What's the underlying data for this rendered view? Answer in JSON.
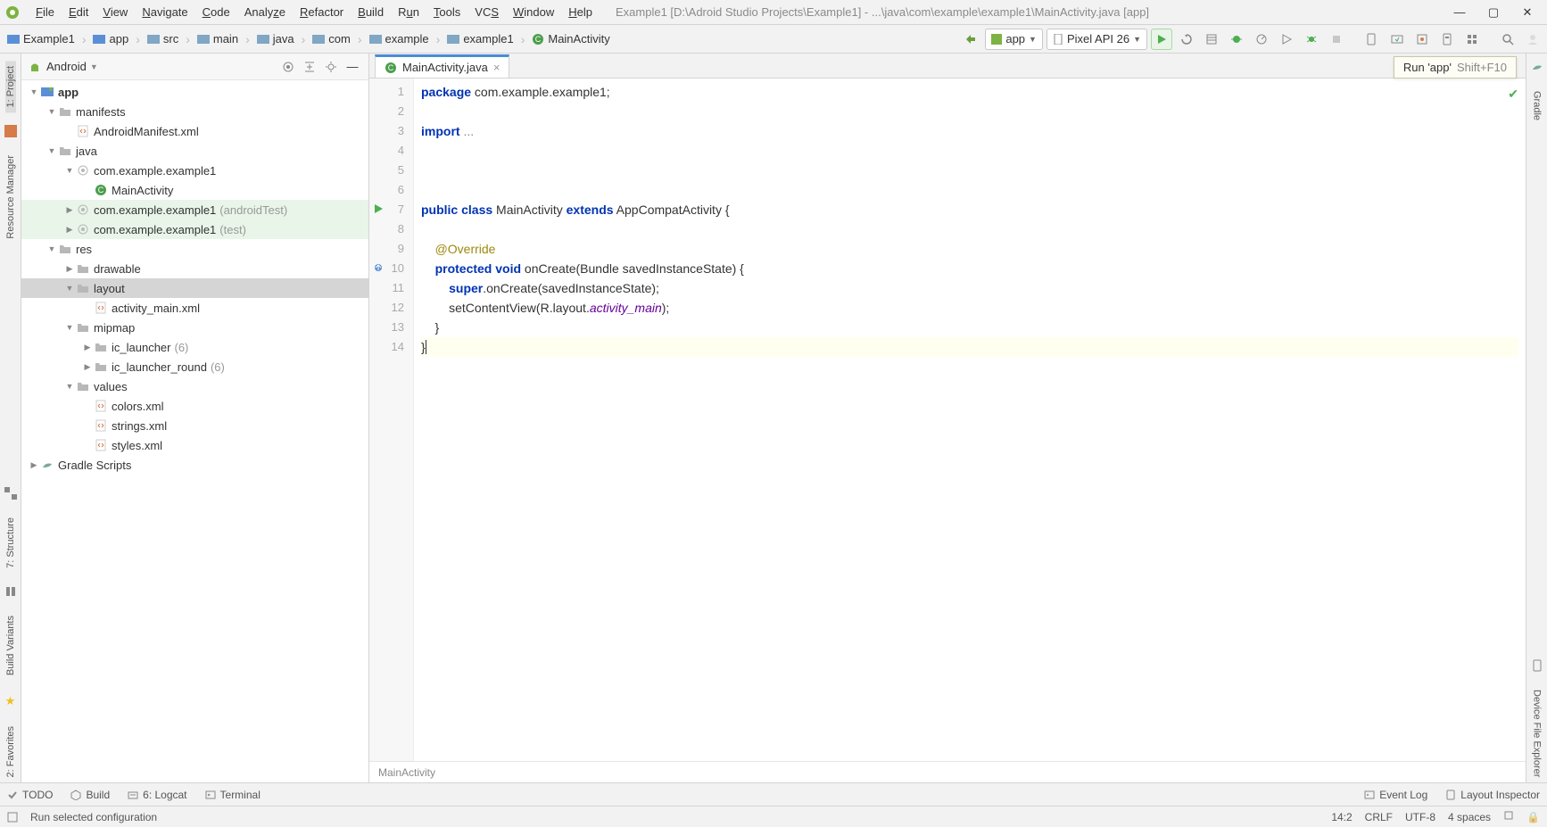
{
  "menu": {
    "items": [
      "File",
      "Edit",
      "View",
      "Navigate",
      "Code",
      "Analyze",
      "Refactor",
      "Build",
      "Run",
      "Tools",
      "VCS",
      "Window",
      "Help"
    ],
    "title": "Example1 [D:\\Adroid Studio Projects\\Example1] - ...\\java\\com\\example\\example1\\MainActivity.java [app]"
  },
  "breadcrumbs": [
    "Example1",
    "app",
    "src",
    "main",
    "java",
    "com",
    "example",
    "example1",
    "MainActivity"
  ],
  "run_config": {
    "module": "app",
    "device": "Pixel API 26"
  },
  "tooltip": {
    "label": "Run 'app'",
    "shortcut": "Shift+F10"
  },
  "project_panel": {
    "header": "Android",
    "tree": [
      {
        "depth": 0,
        "expand": "down",
        "icon": "module",
        "label": "app",
        "bold": true
      },
      {
        "depth": 1,
        "expand": "down",
        "icon": "folder",
        "label": "manifests"
      },
      {
        "depth": 2,
        "expand": "",
        "icon": "xml",
        "label": "AndroidManifest.xml"
      },
      {
        "depth": 1,
        "expand": "down",
        "icon": "folder",
        "label": "java"
      },
      {
        "depth": 2,
        "expand": "down",
        "icon": "pkg",
        "label": "com.example.example1"
      },
      {
        "depth": 3,
        "expand": "",
        "icon": "class",
        "label": "MainActivity"
      },
      {
        "depth": 2,
        "expand": "right",
        "icon": "pkg",
        "label": "com.example.example1",
        "suffix": "(androidTest)",
        "test": true
      },
      {
        "depth": 2,
        "expand": "right",
        "icon": "pkg",
        "label": "com.example.example1",
        "suffix": "(test)",
        "test": true
      },
      {
        "depth": 1,
        "expand": "down",
        "icon": "folder",
        "label": "res"
      },
      {
        "depth": 2,
        "expand": "right",
        "icon": "folder",
        "label": "drawable"
      },
      {
        "depth": 2,
        "expand": "down",
        "icon": "folder",
        "label": "layout",
        "selected": true
      },
      {
        "depth": 3,
        "expand": "",
        "icon": "xml",
        "label": "activity_main.xml"
      },
      {
        "depth": 2,
        "expand": "down",
        "icon": "folder",
        "label": "mipmap"
      },
      {
        "depth": 3,
        "expand": "right",
        "icon": "folder",
        "label": "ic_launcher",
        "suffix": "(6)"
      },
      {
        "depth": 3,
        "expand": "right",
        "icon": "folder",
        "label": "ic_launcher_round",
        "suffix": "(6)"
      },
      {
        "depth": 2,
        "expand": "down",
        "icon": "folder",
        "label": "values"
      },
      {
        "depth": 3,
        "expand": "",
        "icon": "xml",
        "label": "colors.xml"
      },
      {
        "depth": 3,
        "expand": "",
        "icon": "xml",
        "label": "strings.xml"
      },
      {
        "depth": 3,
        "expand": "",
        "icon": "xml",
        "label": "styles.xml"
      },
      {
        "depth": 0,
        "expand": "right",
        "icon": "gradle",
        "label": "Gradle Scripts"
      }
    ]
  },
  "editor": {
    "tab": "MainActivity.java",
    "breadcrumb": "MainActivity",
    "lines": {
      "l1_pkg": "package",
      "l1_rest": " com.example.example1;",
      "l3_imp": "import",
      "l3_rest": " ...",
      "l7_a": "public",
      "l7_b": "class",
      "l7_c": " MainActivity ",
      "l7_d": "extends",
      "l7_e": " AppCompatActivity {",
      "l9": "@Override",
      "l10_a": "protected",
      "l10_b": "void",
      "l10_c": " onCreate(Bundle savedInstanceState) {",
      "l11_a": "super",
      "l11_b": ".onCreate(savedInstanceState);",
      "l12_a": "        setContentView(R.layout.",
      "l12_b": "activity_main",
      "l12_c": ");",
      "l13": "    }",
      "l14": "}"
    },
    "line_numbers": [
      "1",
      "2",
      "3",
      "4",
      "5",
      "6",
      "7",
      "8",
      "9",
      "10",
      "11",
      "12",
      "13",
      "14"
    ]
  },
  "left_strip": {
    "tabs": [
      "1: Project",
      "Resource Manager",
      "7: Structure",
      "Build Variants",
      "2: Favorites"
    ]
  },
  "right_strip": {
    "tabs": [
      "Gradle",
      "Device File Explorer"
    ]
  },
  "bottom_tabs": {
    "left": [
      "TODO",
      "Build",
      "6: Logcat",
      "Terminal"
    ],
    "right": [
      "Event Log",
      "Layout Inspector"
    ]
  },
  "status_bar": {
    "msg": "Run selected configuration",
    "pos": "14:2",
    "eol": "CRLF",
    "enc": "UTF-8",
    "indent": "4 spaces"
  }
}
